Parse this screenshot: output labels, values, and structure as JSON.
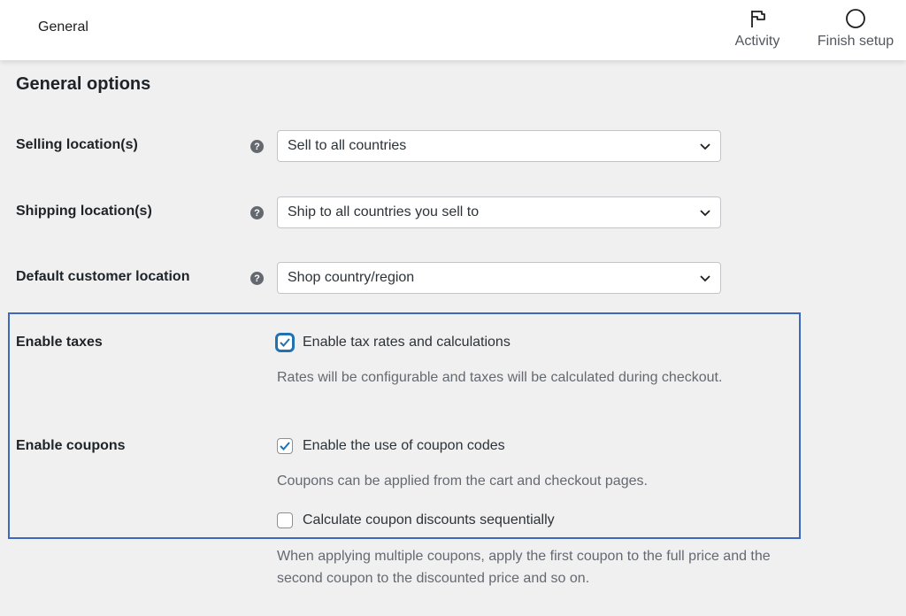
{
  "topbar": {
    "title": "General",
    "activity_label": "Activity",
    "finish_setup_label": "Finish setup"
  },
  "section": {
    "title": "General options"
  },
  "selects": [
    {
      "label": "Selling location(s)",
      "value": "Sell to all countries"
    },
    {
      "label": "Shipping location(s)",
      "value": "Ship to all countries you sell to"
    },
    {
      "label": "Default customer location",
      "value": "Shop country/region"
    }
  ],
  "taxes": {
    "label": "Enable taxes",
    "checkbox_label": "Enable tax rates and calculations",
    "checked": true,
    "description": "Rates will be configurable and taxes will be calculated during checkout."
  },
  "coupons": {
    "label": "Enable coupons",
    "checkbox_label": "Enable the use of coupon codes",
    "checked": true,
    "description": "Coupons can be applied from the cart and checkout pages.",
    "sequential_label": "Calculate coupon discounts sequentially",
    "sequential_checked": false,
    "sequential_description_line1": "When applying multiple coupons, apply the first coupon to the full price and the",
    "sequential_description_line2": "second coupon to the discounted price and so on."
  },
  "colors": {
    "accent": "#2271b1",
    "highlight_border": "#3d68c2"
  }
}
